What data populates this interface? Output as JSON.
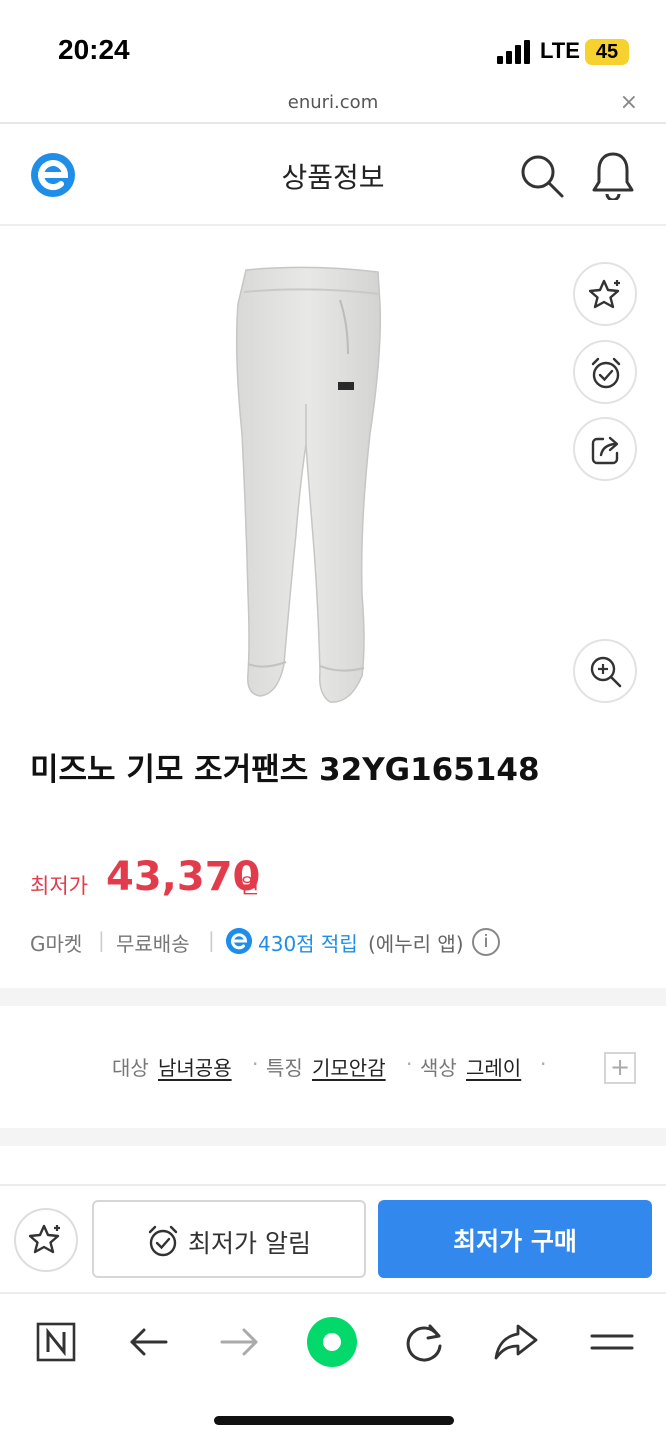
{
  "status_bar": {
    "time": "20:24",
    "network": "LTE",
    "battery": "45"
  },
  "url_bar": {
    "url": "enuri.com",
    "close_symbol": "×"
  },
  "header": {
    "title": "상품정보",
    "logo_icon": "enuri-e-logo",
    "search_icon": "search-icon",
    "bell_icon": "bell-icon"
  },
  "product": {
    "name": "미즈노 기모 조거팬츠 32YG165148",
    "image": "gray-jogger-pants",
    "side_actions": [
      "favorite-star-icon",
      "alarm-clock-icon",
      "share-icon",
      "zoom-in-icon"
    ]
  },
  "price": {
    "label": "최저가",
    "value": "43,370",
    "unit": "원"
  },
  "meta": {
    "seller": "G마켓",
    "shipping": "무료배송",
    "points": "430점 적립",
    "points_note": "(에누리 앱)",
    "info_symbol": "i"
  },
  "specs": [
    {
      "label": "대상",
      "value": "남녀공용"
    },
    {
      "label": "특징",
      "value": "기모안감"
    },
    {
      "label": "색상",
      "value": "그레이"
    }
  ],
  "spec_expand_symbol": "+",
  "actions": {
    "alert_label": "최저가 알림",
    "buy_label": "최저가 구매"
  },
  "colors": {
    "accent_red": "#e23c4c",
    "buy_blue": "#3388ee",
    "brand_blue": "#1e8ee8",
    "naver_green": "#03d96b"
  },
  "browser_toolbar": [
    "naver-n-icon",
    "back-arrow-icon",
    "forward-arrow-icon",
    "green-home-button",
    "refresh-icon",
    "share-arrow-icon",
    "menu-icon"
  ]
}
